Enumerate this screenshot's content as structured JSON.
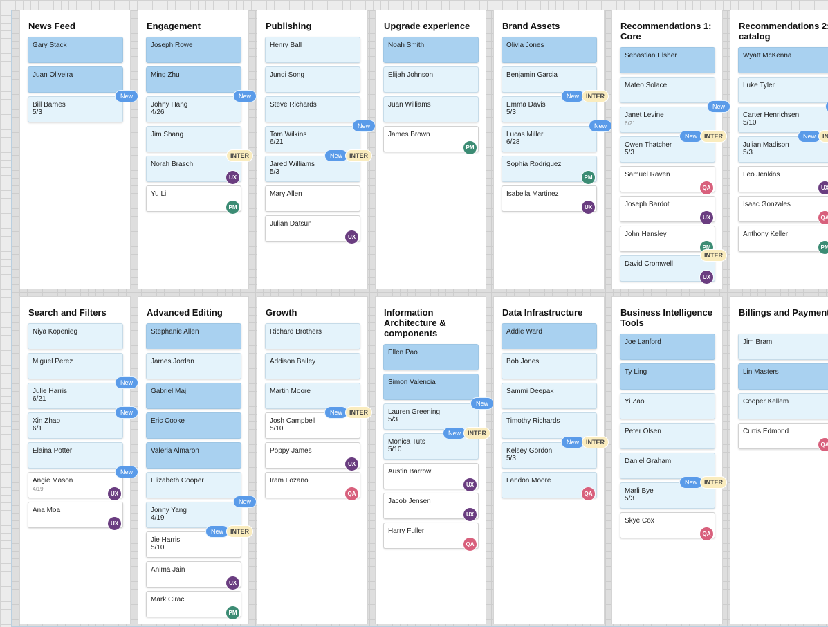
{
  "columns": [
    {
      "title": "News Feed",
      "cards": [
        {
          "name": "Gary Stack"
        },
        {
          "name": "Juan Oliveira"
        },
        {
          "name": "Bill Barnes",
          "date": "5/3"
        }
      ]
    },
    {
      "title": "Engagement",
      "cards": [
        {
          "name": "Joseph Rowe"
        },
        {
          "name": "Ming Zhu"
        },
        {
          "name": "Johny Hang",
          "date": "4/26"
        },
        {
          "name": "Jim Shang"
        },
        {
          "name": "Norah Brasch",
          "badge": "UX"
        },
        {
          "name": "Yu Li",
          "badge": "PM"
        }
      ]
    },
    {
      "title": "Publishing",
      "cards": [
        {
          "name": "Henry Ball"
        },
        {
          "name": "Junqi Song"
        },
        {
          "name": "Steve Richards"
        },
        {
          "name": "Tom Wilkins",
          "date": "6/21"
        },
        {
          "name": "Jared Williams",
          "date": "5/3"
        },
        {
          "name": "Mary Allen"
        },
        {
          "name": "Julian Datsun",
          "badge": "UX"
        }
      ]
    },
    {
      "title": "Upgrade experience",
      "cards": [
        {
          "name": "Noah Smith"
        },
        {
          "name": "Elijah Johnson"
        },
        {
          "name": "Juan Williams"
        },
        {
          "name": "James Brown",
          "badge": "PM"
        }
      ]
    },
    {
      "title": "Brand Assets",
      "cards": [
        {
          "name": "Olivia Jones"
        },
        {
          "name": "Benjamin Garcia"
        },
        {
          "name": "Emma Davis",
          "date": "5/3"
        },
        {
          "name": "Lucas Miller",
          "date": "6/28"
        },
        {
          "name": "Sophia Rodriguez",
          "badge": "PM"
        },
        {
          "name": "Isabella Martinez",
          "badge": "UX"
        }
      ]
    },
    {
      "title": "Recommendations 1: Core",
      "cards": [
        {
          "name": "Sebastian Elsher"
        },
        {
          "name": "Mateo Solace"
        },
        {
          "name": "Janet Levine",
          "date": "6/21"
        },
        {
          "name": "Owen Thatcher",
          "date": "5/3"
        },
        {
          "name": "Samuel Raven",
          "badge": "QA"
        },
        {
          "name": "Joseph Bardot",
          "badge": "UX"
        },
        {
          "name": "John Hansley",
          "badge": "PM"
        },
        {
          "name": "David Cromwell",
          "badge": "UX"
        }
      ]
    },
    {
      "title": "Recommendations 2: catalog",
      "cards": [
        {
          "name": "Wyatt McKenna"
        },
        {
          "name": "Luke Tyler"
        },
        {
          "name": "Carter Henrichsen",
          "date": "5/10"
        },
        {
          "name": "Julian Madison",
          "date": "5/3"
        },
        {
          "name": "Leo Jenkins",
          "badge": "UX"
        },
        {
          "name": "Isaac Gonzales",
          "badge": "QA"
        },
        {
          "name": "Anthony Keller",
          "badge": "PM"
        }
      ]
    },
    {
      "title": "Search and Filters",
      "cards": [
        {
          "name": "Niya Kopenieg"
        },
        {
          "name": "Miguel Perez"
        },
        {
          "name": "Julie Harris",
          "date": "6/21"
        },
        {
          "name": "Xin Zhao",
          "date": "6/1"
        },
        {
          "name": "Elaina Potter"
        },
        {
          "name": "Angie Mason",
          "date": "4/19",
          "badge": "UX"
        },
        {
          "name": "Ana Moa",
          "badge": "UX"
        }
      ]
    },
    {
      "title": "Advanced Editing",
      "cards": [
        {
          "name": "Stephanie Allen"
        },
        {
          "name": "James Jordan"
        },
        {
          "name": "Gabriel Maj"
        },
        {
          "name": "Eric Cooke"
        },
        {
          "name": "Valeria Almaron"
        },
        {
          "name": "Elizabeth Cooper"
        },
        {
          "name": "Jonny Yang",
          "date": "4/19"
        },
        {
          "name": "Jie Harris",
          "date": "5/10"
        },
        {
          "name": "Anima Jain",
          "badge": "UX"
        },
        {
          "name": "Mark Cirac",
          "badge": "PM"
        }
      ]
    },
    {
      "title": "Growth",
      "cards": [
        {
          "name": "Richard Brothers"
        },
        {
          "name": "Addison Bailey"
        },
        {
          "name": "Martin Moore"
        },
        {
          "name": "Josh Campbell",
          "date": "5/10"
        },
        {
          "name": "Poppy James",
          "badge": "UX"
        },
        {
          "name": "Iram Lozano",
          "badge": "QA"
        }
      ]
    },
    {
      "title": "Information Architecture & components",
      "cards": [
        {
          "name": "Ellen Pao"
        },
        {
          "name": "Simon Valencia"
        },
        {
          "name": "Lauren Greening",
          "date": "5/3"
        },
        {
          "name": "Monica Tuts",
          "date": "5/10"
        },
        {
          "name": "Austin Barrow",
          "badge": "UX"
        },
        {
          "name": "Jacob Jensen",
          "badge": "UX"
        },
        {
          "name": "Harry Fuller",
          "badge": "QA"
        }
      ]
    },
    {
      "title": "Data Infrastructure",
      "cards": [
        {
          "name": "Addie Ward"
        },
        {
          "name": "Bob Jones"
        },
        {
          "name": "Sammi Deepak"
        },
        {
          "name": "Timothy Richards"
        },
        {
          "name": "Kelsey Gordon",
          "date": "5/3"
        },
        {
          "name": "Landon Moore",
          "badge": "QA"
        }
      ]
    },
    {
      "title": "Business Intelligence Tools",
      "cards": [
        {
          "name": "Joe Lanford"
        },
        {
          "name": "Ty Ling"
        },
        {
          "name": "Yi Zao"
        },
        {
          "name": "Peter Olsen"
        },
        {
          "name": "Daniel Graham"
        },
        {
          "name": "Marli Bye",
          "date": "5/3"
        },
        {
          "name": "Skye Cox",
          "badge": "QA"
        }
      ]
    },
    {
      "title": "Billings and Payments",
      "cards": [
        {
          "name": "Jim Bram"
        },
        {
          "name": "Lin Masters"
        },
        {
          "name": "Cooper Kellem"
        },
        {
          "name": "Curtis Edmond",
          "badge": "QA"
        }
      ]
    }
  ],
  "labels": {
    "new": "New",
    "inter": "INTER"
  },
  "colors": {
    "card_dark": "#a9d1f0",
    "card_light": "#e4f3fb",
    "card_white": "#ffffff",
    "badge_ux": "#6a3d80",
    "badge_pm": "#3c8c74",
    "badge_qa": "#d8607c",
    "new_pill": "#5a9be9",
    "inter_pill": "#faecbe"
  }
}
